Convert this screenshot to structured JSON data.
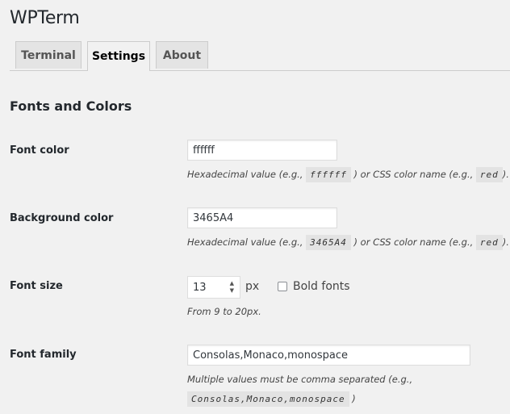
{
  "app": {
    "title": "WPTerm"
  },
  "tabs": [
    {
      "label": "Terminal",
      "active": false
    },
    {
      "label": "Settings",
      "active": true
    },
    {
      "label": "About",
      "active": false
    }
  ],
  "section": {
    "title": "Fonts and Colors"
  },
  "fields": {
    "font_color": {
      "label": "Font color",
      "value": "ffffff",
      "desc_prefix": "Hexadecimal value (e.g.,",
      "desc_example": "ffffff",
      "desc_middle": ") or CSS color name (e.g.,",
      "desc_example2": "red",
      "desc_suffix": ")."
    },
    "background_color": {
      "label": "Background color",
      "value": "3465A4",
      "desc_prefix": "Hexadecimal value (e.g.,",
      "desc_example": "3465A4",
      "desc_middle": ") or CSS color name (e.g.,",
      "desc_example2": "red",
      "desc_suffix": ")."
    },
    "font_size": {
      "label": "Font size",
      "value": "13",
      "unit": "px",
      "spinner_up": "▲",
      "spinner_down": "▼",
      "bold_label": "Bold fonts",
      "bold_checked": false,
      "desc": "From 9 to 20px."
    },
    "font_family": {
      "label": "Font family",
      "value": "Consolas,Monaco,monospace",
      "desc_prefix": "Multiple values must be comma separated (e.g.,",
      "desc_example": "Consolas,Monaco,monospace",
      "desc_suffix": ")"
    }
  }
}
